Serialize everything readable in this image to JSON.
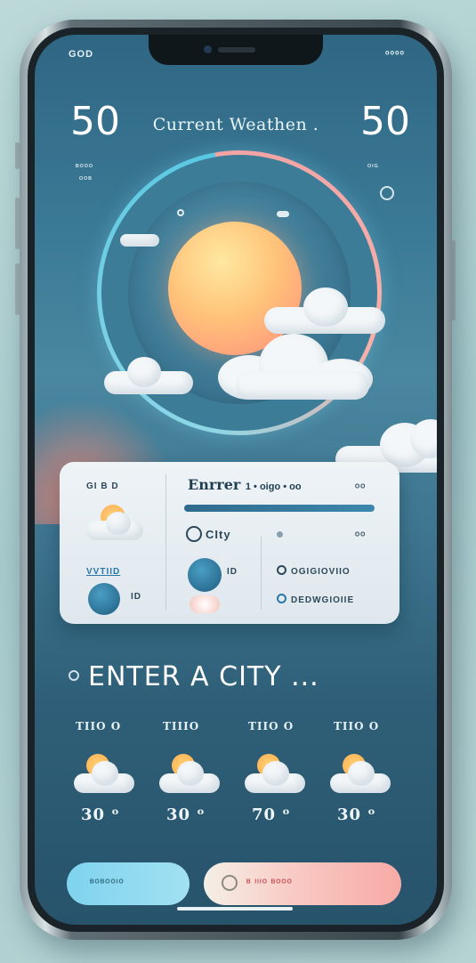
{
  "status": {
    "left": "GOD",
    "right": "ᵒᵒᵒᵒ"
  },
  "header": {
    "temp_left": "50",
    "temp_right": "50",
    "title": "Current Weathen .",
    "label_left_1": "ᴮᴼᴼᴼ",
    "label_left_2": "ᴼᴼᴮ",
    "label_right_1": "ᴼᴵᴳ"
  },
  "card": {
    "label_top_left": "GI B  D",
    "heading": "Enrrer",
    "heading_tail": "1 • oigo • oo",
    "city_label": "CIty",
    "blue_link": "VVTIID",
    "right_text_1": "OGIGIOVIIO",
    "right_text_2": "DEDWGIOIIE",
    "small_1": "ID",
    "small_2": "ID",
    "small_3": "ᴼᴼ",
    "small_4": "ᴼᴼ"
  },
  "cta": {
    "text": "ENTER A CITY ..."
  },
  "forecast": [
    {
      "day": "TIIO O",
      "temp": "30 ᵒ"
    },
    {
      "day": "TIIIO",
      "temp": "30 ᵒ"
    },
    {
      "day": "TIIO O",
      "temp": "70 ᵒ"
    },
    {
      "day": "TIIO O",
      "temp": "30 ᵒ"
    }
  ],
  "bottom": {
    "left_label": "ᴮᴼᴮᴼᴼᴵᴼ",
    "right_label": "ᴮ ᴵᴵᴵᴼ ᴮᴼᴼᴼ"
  },
  "colors": {
    "accent": "#57c8e3",
    "warm": "#f7aaa6"
  }
}
